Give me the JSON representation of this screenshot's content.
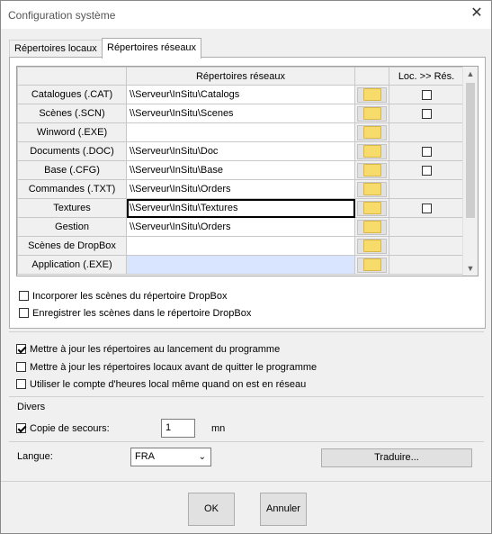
{
  "window": {
    "title": "Configuration système",
    "close_label": "✕"
  },
  "tabs": [
    {
      "label": "Répertoires locaux"
    },
    {
      "label": "Répertoires réseaux"
    }
  ],
  "grid": {
    "headers": {
      "col1": "",
      "col2": "Répertoires réseaux",
      "col3": "",
      "col4": "Loc. >> Rés."
    },
    "rows": [
      {
        "label": "Catalogues (.CAT)",
        "path": "\\\\Serveur\\InSitu\\Catalogs",
        "checkbox": "unchecked"
      },
      {
        "label": "Scènes (.SCN)",
        "path": "\\\\Serveur\\InSitu\\Scenes",
        "checkbox": "unchecked"
      },
      {
        "label": "Winword (.EXE)",
        "path": "",
        "checkbox": "none"
      },
      {
        "label": "Documents (.DOC)",
        "path": "\\\\Serveur\\InSitu\\Doc",
        "checkbox": "unchecked"
      },
      {
        "label": "Base (.CFG)",
        "path": "\\\\Serveur\\InSitu\\Base",
        "checkbox": "unchecked"
      },
      {
        "label": "Commandes (.TXT)",
        "path": "\\\\Serveur\\InSitu\\Orders",
        "checkbox": "none"
      },
      {
        "label": "Textures",
        "path": "\\\\Serveur\\InSitu\\Textures",
        "checkbox": "unchecked",
        "selected": true
      },
      {
        "label": "Gestion",
        "path": "\\\\Serveur\\InSitu\\Orders",
        "checkbox": "none"
      },
      {
        "label": "Scènes de DropBox",
        "path": "",
        "checkbox": "none"
      },
      {
        "label": "Application (.EXE)",
        "path": "",
        "checkbox": "none",
        "highlight": true
      }
    ]
  },
  "dropbox_options": {
    "incorporate": {
      "label": "Incorporer les scènes du répertoire DropBox",
      "checked": false
    },
    "save": {
      "label": "Enregistrer les scènes dans le répertoire DropBox",
      "checked": false
    }
  },
  "options": {
    "update_on_launch": {
      "label": "Mettre à jour les répertoires au lancement du programme",
      "checked": true
    },
    "update_local_before_quit": {
      "label": "Mettre à jour les répertoires locaux avant de quitter le programme",
      "checked": false
    },
    "use_local_hours": {
      "label": "Utiliser le compte d'heures local même quand on est en réseau",
      "checked": false
    }
  },
  "divers": {
    "title": "Divers",
    "backup_label": "Copie de secours:",
    "backup_checked": true,
    "backup_value": "1",
    "backup_unit": "mn"
  },
  "language": {
    "label": "Langue:",
    "selected": "FRA",
    "translate_button": "Traduire..."
  },
  "footer": {
    "ok": "OK",
    "cancel": "Annuler"
  },
  "icons": {
    "folder": "folder-icon",
    "chevron": "chevron-down-icon"
  }
}
